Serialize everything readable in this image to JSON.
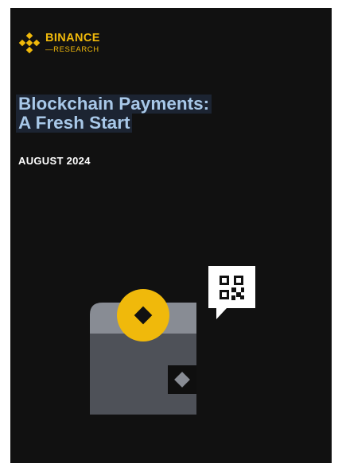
{
  "logo": {
    "brand": "BINANCE",
    "sub": "RESEARCH",
    "icon": "binance-diamond-icon"
  },
  "title": {
    "line1": "Blockchain Payments:",
    "line2": "A Fresh Start"
  },
  "date": "AUGUST 2024",
  "illustration": {
    "elements": [
      "wallet-icon",
      "coin-icon",
      "qr-code-speech-bubble-icon"
    ]
  },
  "colors": {
    "background": "#111111",
    "accent_yellow": "#f0b90b",
    "title_blue": "#a8c8e8",
    "wallet_gray": "#5a5d64",
    "wallet_top": "#888c94"
  }
}
